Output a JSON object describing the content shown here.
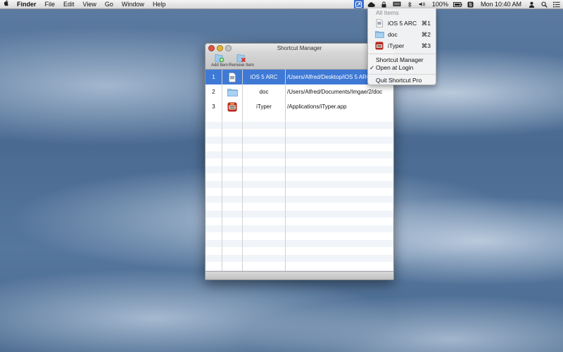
{
  "menubar": {
    "app_name": "Finder",
    "menus": [
      "File",
      "Edit",
      "View",
      "Go",
      "Window",
      "Help"
    ],
    "battery": "100%",
    "clock": "Mon 10:40 AM"
  },
  "dropdown": {
    "header": "All Items",
    "items": [
      {
        "label": "iOS 5 ARC",
        "shortcut": "⌘1",
        "icon": "document-icon"
      },
      {
        "label": "doc",
        "shortcut": "⌘2",
        "icon": "folder-icon"
      },
      {
        "label": "iTyper",
        "shortcut": "⌘3",
        "icon": "app-icon"
      }
    ],
    "manager_label": "Shortcut Manager",
    "open_at_login_label": "Open at Login",
    "open_at_login_checked": true,
    "quit_label": "Quit Shortcut Pro"
  },
  "window": {
    "title": "Shortcut Manager",
    "toolbar": {
      "add_label": "Add Item",
      "remove_label": "Remove Item"
    },
    "rows": [
      {
        "num": "1",
        "name": "iOS 5 ARC",
        "path": "/Users/Alfred/Desktop/iOS 5 ARC",
        "icon": "document-icon",
        "selected": true
      },
      {
        "num": "2",
        "name": "doc",
        "path": "/Users/Alfred/Documents/Imgae/2/doc",
        "icon": "folder-icon",
        "selected": false
      },
      {
        "num": "3",
        "name": "iTyper",
        "path": "/Applications/iTyper.app",
        "icon": "app-icon",
        "selected": false
      }
    ]
  },
  "colors": {
    "selection": "#3e79d6",
    "menu_highlight": "#3b6fd0",
    "close": "#e0533f",
    "minimize": "#e3b42f"
  }
}
